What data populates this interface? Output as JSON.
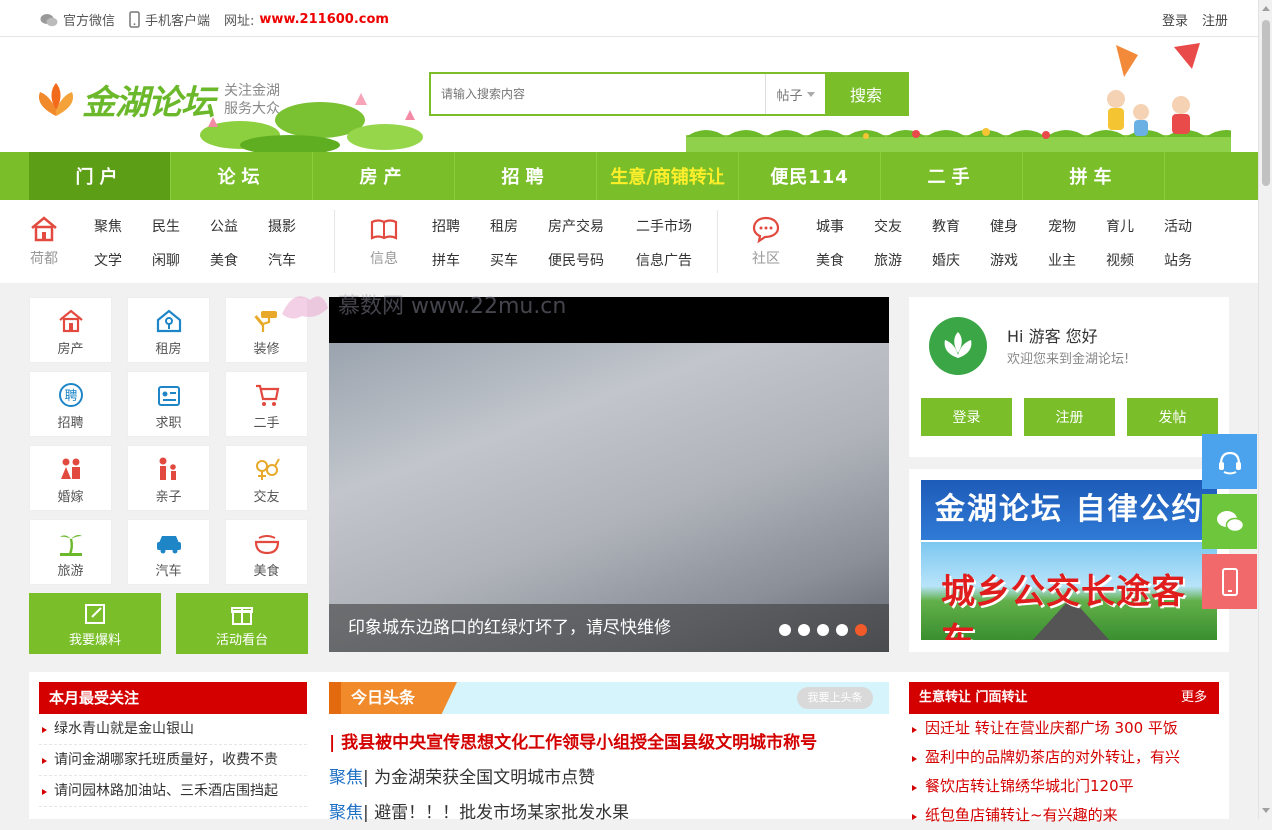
{
  "topbar": {
    "wechat": "官方微信",
    "mobile": "手机客户端",
    "site_label": "网址:",
    "site_url": "www.211600.com",
    "login": "登录",
    "register": "注册"
  },
  "header": {
    "logo_name": "金湖论坛",
    "slogan_line1": "关注金湖",
    "slogan_line2": "服务大众",
    "search_placeholder": "请输入搜索内容",
    "search_scope": "帖子",
    "search_button": "搜索"
  },
  "nav": {
    "items": [
      "门户",
      "论坛",
      "房产",
      "招聘",
      "生意/商铺转让",
      "便民114",
      "二手",
      "拼车"
    ]
  },
  "subnav": {
    "groups": [
      {
        "category": "荷都",
        "links": [
          "聚焦",
          "民生",
          "公益",
          "摄影",
          "文学",
          "闲聊",
          "美食",
          "汽车"
        ]
      },
      {
        "category": "信息",
        "links": [
          "招聘",
          "租房",
          "房产交易",
          "二手市场",
          "拼车",
          "买车",
          "便民号码",
          "信息广告"
        ]
      },
      {
        "category": "社区",
        "links": [
          "城事",
          "交友",
          "教育",
          "健身",
          "宠物",
          "育儿",
          "活动",
          "美食",
          "旅游",
          "婚庆",
          "游戏",
          "业主",
          "视频",
          "站务"
        ]
      }
    ]
  },
  "quick": {
    "cells": [
      {
        "label": "房产",
        "icon": "house-icon",
        "color": "#e24a3f"
      },
      {
        "label": "租房",
        "icon": "rent-house-icon",
        "color": "#1e86c7"
      },
      {
        "label": "装修",
        "icon": "paint-roller-icon",
        "color": "#e8a92a"
      },
      {
        "label": "招聘",
        "icon": "hire-icon",
        "color": "#1e86c7"
      },
      {
        "label": "求职",
        "icon": "resume-icon",
        "color": "#1e86c7"
      },
      {
        "label": "二手",
        "icon": "cart-icon",
        "color": "#e24a3f"
      },
      {
        "label": "婚嫁",
        "icon": "couple-icon",
        "color": "#e24a3f"
      },
      {
        "label": "亲子",
        "icon": "family-icon",
        "color": "#e24a3f"
      },
      {
        "label": "交友",
        "icon": "gender-icon",
        "color": "#e8a92a"
      },
      {
        "label": "旅游",
        "icon": "palm-tree-icon",
        "color": "#6bb82b"
      },
      {
        "label": "汽车",
        "icon": "car-icon",
        "color": "#1e86c7"
      },
      {
        "label": "美食",
        "icon": "bowl-icon",
        "color": "#e24a3f"
      }
    ],
    "report_button": "我要爆料",
    "events_button": "活动看台"
  },
  "slider": {
    "caption": "印象城东边路口的红绿灯坏了，请尽快维修",
    "slide_count": 5,
    "active_slide": 5
  },
  "watermark": "慕数网 www.22mu.cn",
  "user": {
    "greeting": "Hi 游客 您好",
    "welcome": "欢迎您来到金湖论坛!",
    "login": "登录",
    "register": "注册",
    "post": "发帖"
  },
  "banners": {
    "banner1": "金湖论坛 自律公约",
    "banner2": "城乡公交长途客车"
  },
  "hot": {
    "title": "本月最受关注",
    "items": [
      "绿水青山就是金山银山",
      "请问金湖哪家托班质量好，收费不贵",
      "请问园林路加油站、三禾酒店围挡起"
    ]
  },
  "headlines": {
    "title": "今日头条",
    "more": "我要上头条",
    "top": "| 我县被中央宣传思想文化工作领导小组授全国县级文明城市称号",
    "rows": [
      {
        "tag": "聚焦",
        "text": "| 为金湖荣获全国文明城市点赞"
      },
      {
        "tag": "聚焦",
        "text": "| 避雷！！！批发市场某家批发水果"
      }
    ]
  },
  "shops": {
    "title": "生意转让 门面转让",
    "more": "更多",
    "items": [
      "因迁址 转让在营业庆都广场 300 平饭",
      "盈利中的品牌奶茶店的对外转让，有兴",
      "餐饮店转让锦绣华城北门120平",
      "纸包鱼店铺转让~有兴趣的来"
    ]
  },
  "colors": {
    "brand_green": "#7abf2a",
    "accent_red": "#d40000",
    "accent_orange": "#f08a2a"
  }
}
